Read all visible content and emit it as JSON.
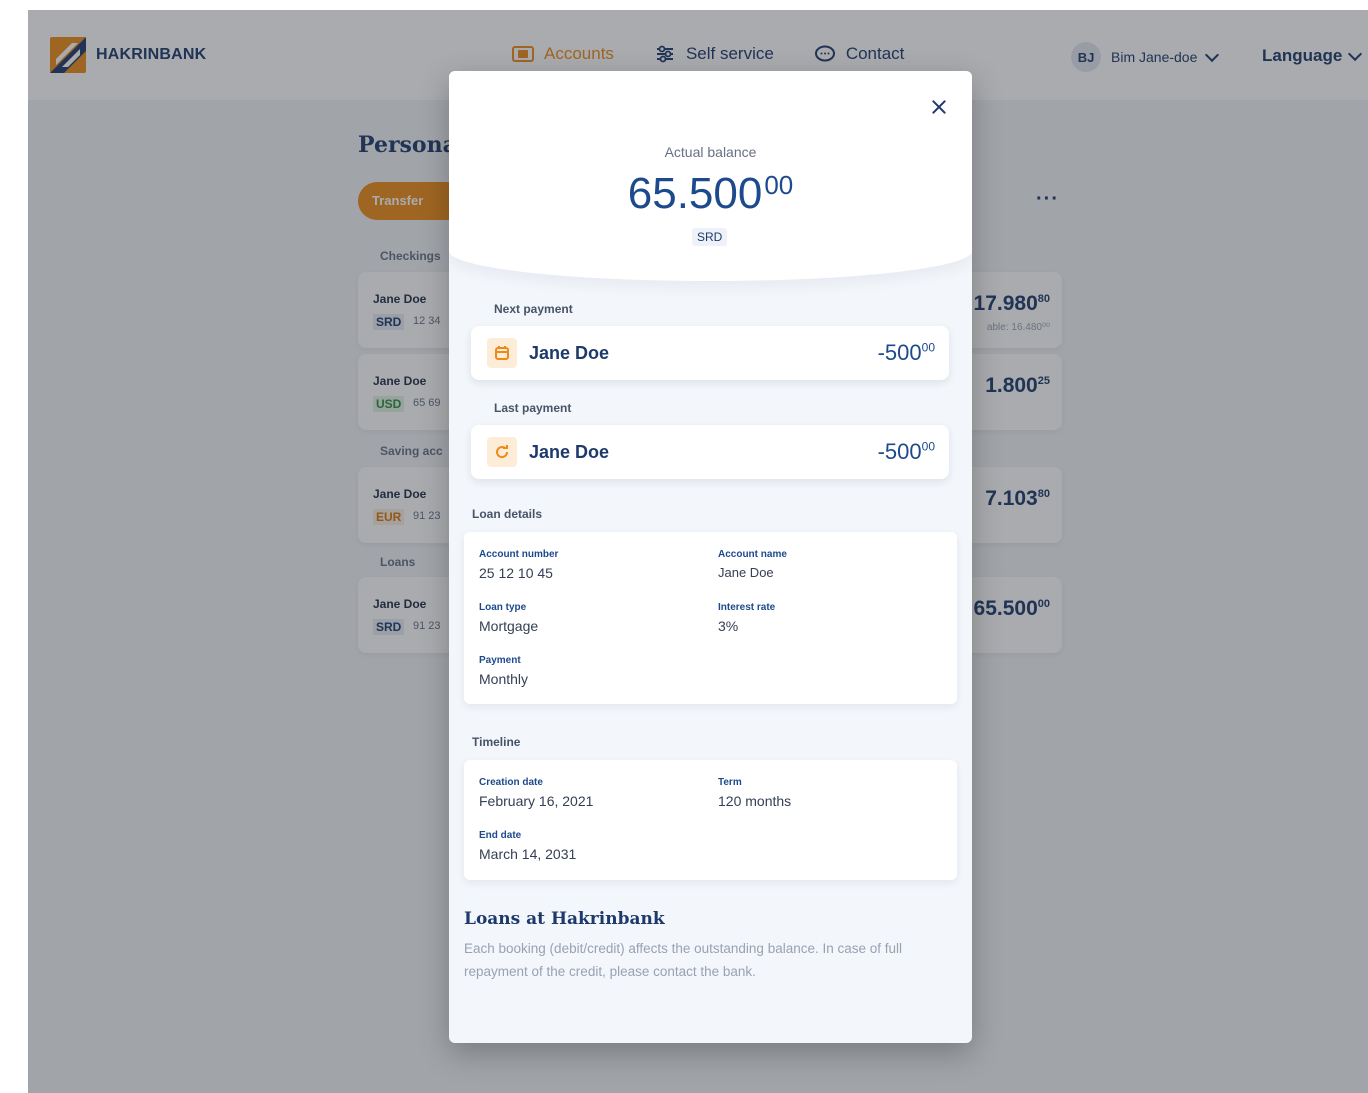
{
  "brand": {
    "name": "HAKRINBANK",
    "colors": {
      "primary": "#1d3a6b",
      "accent": "#ef8a17"
    }
  },
  "nav": {
    "items": [
      {
        "label": "Accounts",
        "icon": "wallet-icon",
        "active": true
      },
      {
        "label": "Self service",
        "icon": "sliders-icon",
        "active": false
      },
      {
        "label": "Contact",
        "icon": "chat-bubble-icon",
        "active": false
      }
    ]
  },
  "user": {
    "initials": "BJ",
    "name": "Bim Jane-doe"
  },
  "language": {
    "label": "Language"
  },
  "background": {
    "title": "Personal",
    "transfer_label": "Transfer",
    "more_label": "···",
    "sections": {
      "checkings": "Checkings",
      "savings": "Saving acc",
      "loans": "Loans"
    },
    "accounts": [
      {
        "name": "Jane Doe",
        "currency": "SRD",
        "number": "12 34",
        "balance_main": "17.980",
        "balance_cents": "80",
        "available": "able: 16.480⁰⁰"
      },
      {
        "name": "Jane Doe",
        "currency": "USD",
        "number": "65 69",
        "balance_main": "1.800",
        "balance_cents": "25"
      },
      {
        "name": "Jane Doe",
        "currency": "EUR",
        "number": "91 23",
        "balance_main": "7.103",
        "balance_cents": "80"
      },
      {
        "name": "Jane Doe",
        "currency": "SRD",
        "number": "91 23",
        "balance_main": "65.500",
        "balance_cents": "00"
      }
    ]
  },
  "modal": {
    "balance_label": "Actual balance",
    "balance_main": "65.500",
    "balance_cents": "00",
    "currency": "SRD",
    "next_payment": {
      "label": "Next payment",
      "name": "Jane Doe",
      "amount_main": "-500",
      "amount_cents": "00",
      "icon": "calendar-icon"
    },
    "last_payment": {
      "label": "Last payment",
      "name": "Jane Doe",
      "amount_main": "-500",
      "amount_cents": "00",
      "icon": "refresh-icon"
    },
    "loan_details": {
      "title": "Loan details",
      "account_number_label": "Account number",
      "account_number": "25 12 10 45",
      "account_name_label": "Account name",
      "account_name": "Jane Doe",
      "loan_type_label": "Loan type",
      "loan_type": "Mortgage",
      "interest_rate_label": "Interest rate",
      "interest_rate": "3%",
      "payment_label": "Payment",
      "payment": "Monthly"
    },
    "timeline": {
      "title": "Timeline",
      "creation_date_label": "Creation date",
      "creation_date": "February 16, 2021",
      "term_label": "Term",
      "term": "120 months",
      "end_date_label": "End date",
      "end_date": "March 14, 2031"
    },
    "info": {
      "title": "Loans at Hakrinbank",
      "text": "Each booking (debit/credit) affects the outstanding balance. In case of full repayment of the credit, please contact the bank."
    }
  }
}
